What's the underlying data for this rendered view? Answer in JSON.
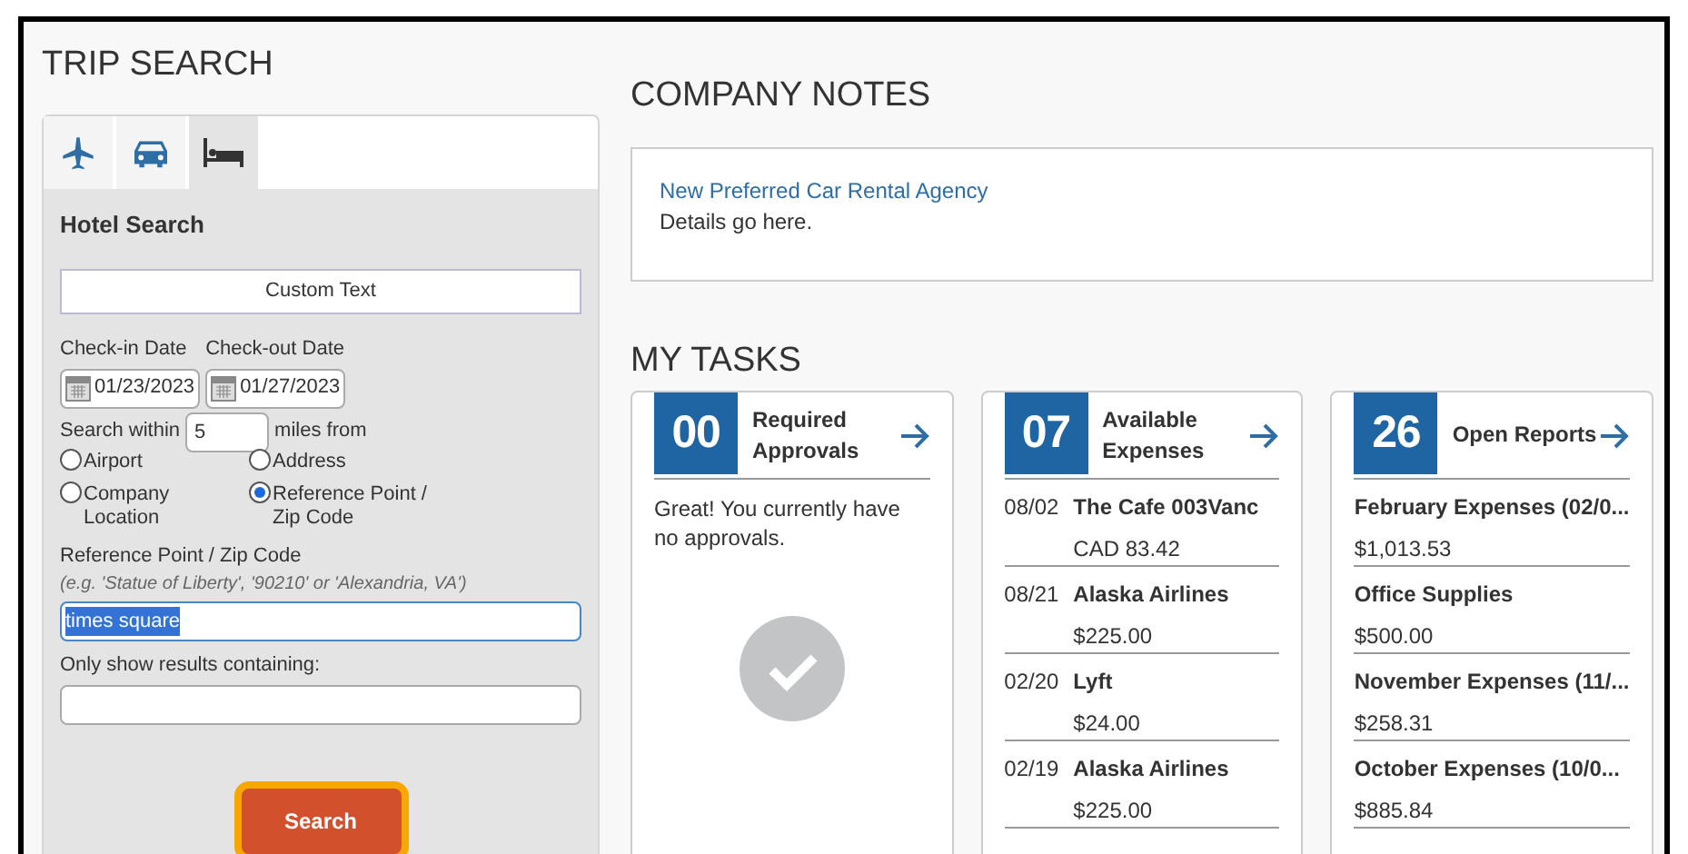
{
  "trip_search": {
    "title": "TRIP SEARCH",
    "tabs": [
      {
        "kind": "plane",
        "selected": false
      },
      {
        "kind": "car",
        "selected": false
      },
      {
        "kind": "bed",
        "selected": true
      }
    ],
    "heading": "Hotel Search",
    "custom_text": "Custom Text",
    "check_in": {
      "label": "Check-in Date",
      "value": "01/23/2023"
    },
    "check_out": {
      "label": "Check-out Date",
      "value": "01/27/2023"
    },
    "search_within": {
      "label": "Search within",
      "value": "5",
      "suffix": "miles from"
    },
    "radios": [
      {
        "label": "Airport",
        "selected": false
      },
      {
        "label": "Address",
        "selected": false
      },
      {
        "label": "Company Location",
        "selected": false
      },
      {
        "label": "Reference Point / Zip Code",
        "selected": true
      }
    ],
    "reference": {
      "label": "Reference Point / Zip Code",
      "hint": "(e.g. 'Statue of Liberty', '90210' or 'Alexandria, VA')",
      "value": "times square"
    },
    "filter": {
      "label": "Only show results containing:"
    },
    "search_button": "Search"
  },
  "company_notes": {
    "title": "COMPANY NOTES",
    "link": "New Preferred Car Rental Agency",
    "text": "Details go here."
  },
  "my_tasks": {
    "title": "MY TASKS",
    "cards": [
      {
        "count": "00",
        "label": "Required Approvals",
        "kind": "message",
        "message": "Great! You currently have no approvals."
      },
      {
        "count": "07",
        "label": "Available Expenses",
        "kind": "dated",
        "items": [
          {
            "date": "08/02",
            "name": "The Cafe 003Vanc",
            "amount": "CAD 83.42"
          },
          {
            "date": "08/21",
            "name": "Alaska Airlines",
            "amount": "$225.00"
          },
          {
            "date": "02/20",
            "name": "Lyft",
            "amount": "$24.00"
          },
          {
            "date": "02/19",
            "name": "Alaska Airlines",
            "amount": "$225.00"
          }
        ]
      },
      {
        "count": "26",
        "label": "Open Reports",
        "kind": "plain",
        "items": [
          {
            "name": "February Expenses (02/0...",
            "amount": "$1,013.53"
          },
          {
            "name": "Office Supplies",
            "amount": "$500.00"
          },
          {
            "name": "November Expenses (11/...",
            "amount": "$258.31"
          },
          {
            "name": "October Expenses (10/0...",
            "amount": "$885.84"
          }
        ]
      }
    ]
  }
}
